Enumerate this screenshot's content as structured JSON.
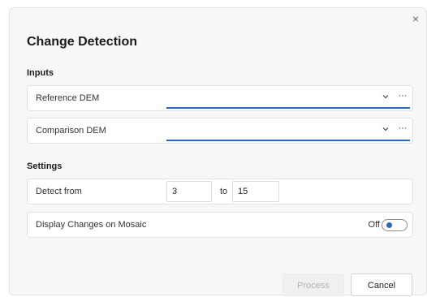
{
  "dialog": {
    "title": "Change Detection",
    "close_label": "×"
  },
  "inputs": {
    "section_label": "Inputs",
    "reference_dem": {
      "label": "Reference DEM",
      "value": "",
      "browse_label": "···"
    },
    "comparison_dem": {
      "label": "Comparison DEM",
      "value": "",
      "browse_label": "···"
    }
  },
  "settings": {
    "section_label": "Settings",
    "detect_from": {
      "label": "Detect from",
      "from_value": "3",
      "to_label": "to",
      "to_value": "15"
    },
    "display_changes": {
      "label": "Display Changes on Mosaic",
      "state_label": "Off",
      "checked": false
    }
  },
  "buttons": {
    "process_label": "Process",
    "cancel_label": "Cancel"
  },
  "colors": {
    "accent": "#2a69b8",
    "dialog_bg": "#f7f7f9",
    "row_bg": "#ffffff"
  },
  "icons": {
    "close": "close-icon",
    "chevron": "chevron-down-icon",
    "browse": "ellipsis-icon"
  }
}
